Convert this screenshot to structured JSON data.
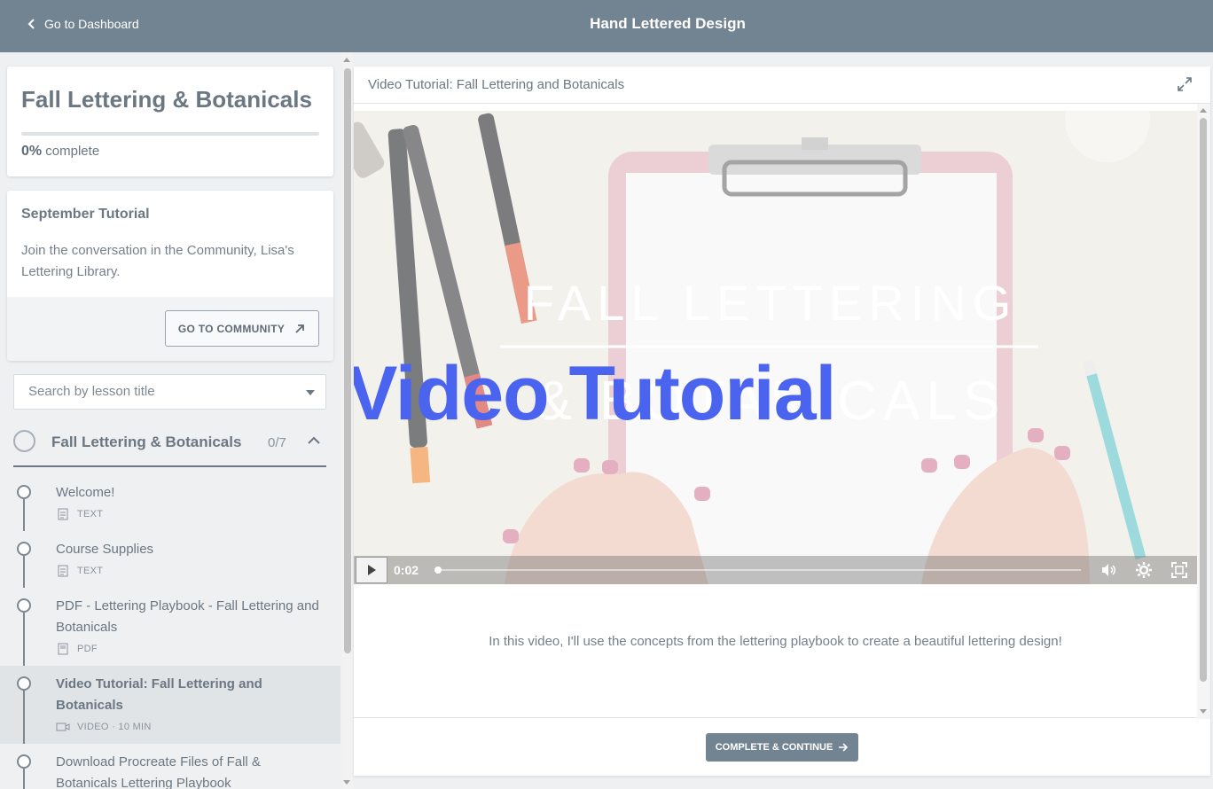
{
  "topbar": {
    "back_label": "Go to Dashboard",
    "course_title": "Hand Lettered Design"
  },
  "sidebar": {
    "course_name": "Fall Lettering & Botanicals",
    "progress_percent": "0%",
    "progress_suffix": "complete",
    "progress_fraction": 0,
    "info_card": {
      "title": "September Tutorial",
      "body": "Join the conversation in the Community, Lisa's Lettering Library.",
      "button_label": "GO TO COMMUNITY"
    },
    "search": {
      "placeholder": "Search by lesson title"
    },
    "chapter": {
      "name": "Fall Lettering & Botanicals",
      "count": "0/7"
    },
    "lessons": [
      {
        "title": "Welcome!",
        "meta": "TEXT",
        "icon": "text-doc-icon"
      },
      {
        "title": "Course Supplies",
        "meta": "TEXT",
        "icon": "text-doc-icon"
      },
      {
        "title": "PDF - Lettering Playbook - Fall Lettering and Botanicals",
        "meta": "PDF",
        "icon": "pdf-icon"
      },
      {
        "title": "Video Tutorial: Fall Lettering and Botanicals",
        "meta": "VIDEO · 10 MIN",
        "icon": "video-camera-icon",
        "active": true
      },
      {
        "title": "Download Procreate Files of Fall & Botanicals Lettering Playbook",
        "meta": "",
        "icon": ""
      }
    ]
  },
  "main": {
    "lesson_title": "Video Tutorial: Fall Lettering and Botanicals",
    "video": {
      "frame_heading_line1": "FALL LETTERING",
      "frame_heading_line2": "& BOTANICALS",
      "overlay_title": "Video Tutorial",
      "time": "0:02",
      "progress_fraction": 0.0
    },
    "description": "In this video, I'll use the concepts from the lettering playbook to create a beautiful lettering design!",
    "complete_button": "COMPLETE & CONTINUE"
  },
  "colors": {
    "topbar": "#728492",
    "accent": "#728492",
    "overlay_text": "#4a64f0"
  }
}
